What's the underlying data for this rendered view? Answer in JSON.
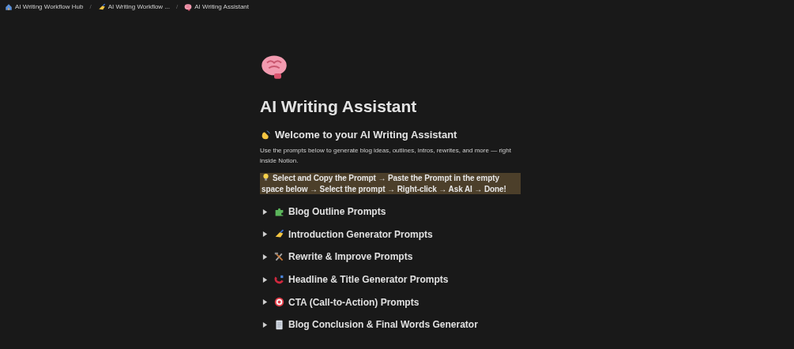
{
  "breadcrumbs": [
    {
      "label": "AI Writing Workflow Hub"
    },
    {
      "separator": "/",
      "label": "AI Writing Workflow ..."
    },
    {
      "separator": "/",
      "label": "AI Writing Assistant"
    }
  ],
  "page": {
    "title": "AI Writing Assistant"
  },
  "welcome": {
    "heading": "Welcome to your AI Writing Assistant",
    "text": "Use the prompts below to generate blog ideas, outlines, intros, rewrites, and more — right inside Notion."
  },
  "callout": {
    "text": "Select and Copy the Prompt → Paste the Prompt in the empty space below → Select the prompt → Right-click → Ask AI → Done!",
    "highlighted": true
  },
  "toggles": [
    {
      "label": "Blog Outline Prompts",
      "expanded": false
    },
    {
      "label": "Introduction Generator Prompts",
      "expanded": false
    },
    {
      "label": "Rewrite & Improve Prompts",
      "expanded": false
    },
    {
      "label": "Headline & Title Generator Prompts",
      "expanded": false
    },
    {
      "label": "CTA (Call-to-Action) Prompts",
      "expanded": false
    },
    {
      "label": "Blog Conclusion & Final Words Generator",
      "expanded": false
    }
  ]
}
